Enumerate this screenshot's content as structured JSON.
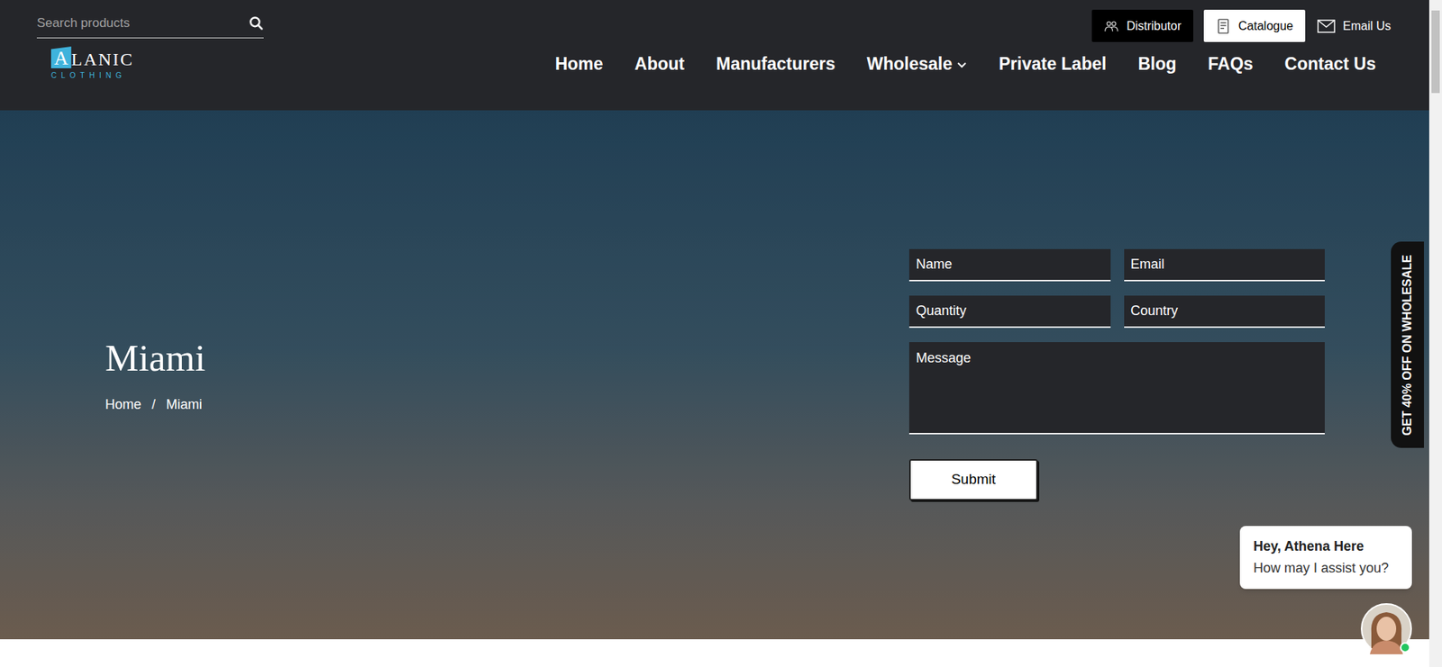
{
  "search": {
    "placeholder": "Search products"
  },
  "top_buttons": [
    {
      "label": "Distributor",
      "kind": "dark"
    },
    {
      "label": "Catalogue",
      "kind": "light"
    },
    {
      "label": "Email Us",
      "kind": "plain"
    }
  ],
  "logo": {
    "initial": "A",
    "rest": "LANIC",
    "tagline": "CLOTHING"
  },
  "nav": [
    {
      "label": "Home",
      "kind": "link"
    },
    {
      "label": "About",
      "kind": "link"
    },
    {
      "label": "Manufacturers",
      "kind": "link"
    },
    {
      "label": "Wholesale",
      "kind": "dropdown"
    },
    {
      "label": "Private Label",
      "kind": "link"
    },
    {
      "label": "Blog",
      "kind": "link"
    },
    {
      "label": "FAQs",
      "kind": "link"
    },
    {
      "label": "Contact Us",
      "kind": "link"
    }
  ],
  "hero": {
    "title": "Miami",
    "breadcrumb": [
      "Home",
      "/",
      "Miami"
    ]
  },
  "form": {
    "fields": [
      {
        "placeholder": "Name",
        "kind": "input"
      },
      {
        "placeholder": "Email",
        "kind": "input"
      },
      {
        "placeholder": "Quantity",
        "kind": "input"
      },
      {
        "placeholder": "Country",
        "kind": "input"
      },
      {
        "placeholder": "Message",
        "kind": "textarea"
      }
    ],
    "submit": "Submit"
  },
  "side_tab": "GET 40% OFF ON WHOLESALE",
  "chat": {
    "title": "Hey, Athena Here",
    "message": "How may I assist you?",
    "online": true
  }
}
